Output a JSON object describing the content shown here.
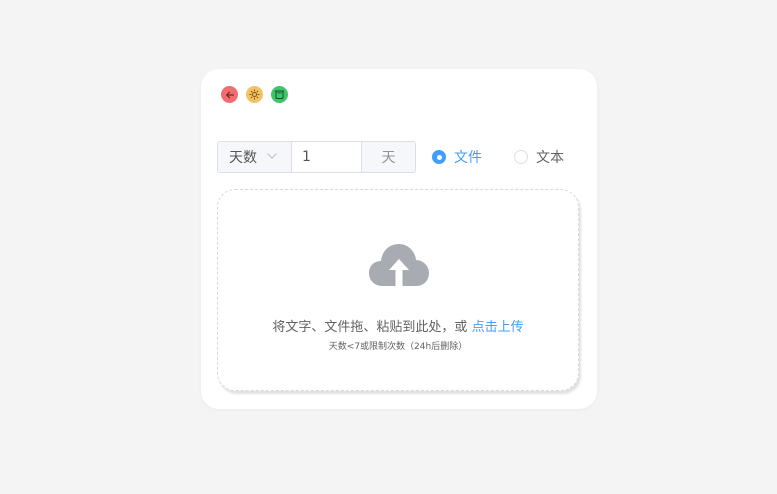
{
  "window": {
    "buttons": [
      {
        "icon": "arrow-left-icon",
        "color": "#f16d6d"
      },
      {
        "icon": "sun-icon",
        "color": "#f4c266"
      },
      {
        "icon": "trash-icon",
        "color": "#3fc46a"
      }
    ]
  },
  "limit": {
    "type_selected": "天数",
    "value": "1",
    "unit": "天"
  },
  "mode": {
    "options": [
      {
        "label": "文件",
        "checked": true
      },
      {
        "label": "文本",
        "checked": false
      }
    ]
  },
  "upload": {
    "hint_text": "将文字、文件拖、粘贴到此处，或",
    "hint_link": "点击上传",
    "tip": "天数<7或限制次数（24h后删除）"
  },
  "colors": {
    "accent": "#409eff",
    "background": "#f4f4f5",
    "card": "#ffffff"
  }
}
